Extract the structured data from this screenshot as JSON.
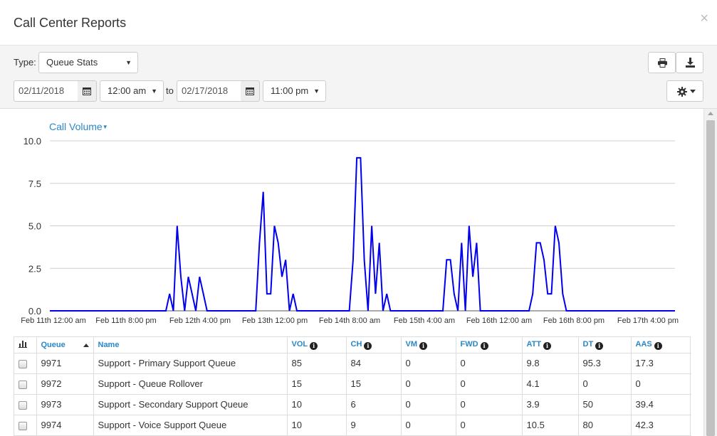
{
  "dialog": {
    "title": "Call Center Reports",
    "close_label": "×"
  },
  "filters": {
    "type_label": "Type:",
    "type_value": "Queue Stats",
    "start_date": "02/11/2018",
    "start_time": "12:00 am",
    "to_label": "to",
    "end_date": "02/17/2018",
    "end_time": "11:00 pm"
  },
  "icons": {
    "print": "print-icon",
    "download": "download-icon",
    "settings": "gear-icon",
    "calendar": "calendar-icon",
    "close": "close-icon",
    "info": "info-icon",
    "chart_columns": "bar-chart-icon"
  },
  "colors": {
    "accent": "#2a87c8",
    "series": "#0000ee"
  },
  "chart_data": {
    "type": "line",
    "title": "Call Volume",
    "xlabel": "",
    "ylabel": "",
    "ylim": [
      0,
      10
    ],
    "yticks": [
      "0.0",
      "2.5",
      "5.0",
      "7.5",
      "10.0"
    ],
    "xticks": [
      "Feb 11th 12:00 am",
      "Feb 11th 8:00 pm",
      "Feb 12th 4:00 pm",
      "Feb 13th 12:00 pm",
      "Feb 14th 8:00 am",
      "Feb 15th 4:00 am",
      "Feb 16th 12:00 am",
      "Feb 16th 8:00 pm",
      "Feb 17th 4:00 pm"
    ],
    "x_unit": "hours from Feb 11th 12:00 am",
    "grid": true,
    "series": [
      {
        "name": "Call Volume",
        "color": "#0000ee",
        "points": [
          [
            0,
            0
          ],
          [
            31,
            0
          ],
          [
            32,
            1
          ],
          [
            33,
            0
          ],
          [
            34,
            5
          ],
          [
            35,
            2
          ],
          [
            36,
            0
          ],
          [
            37,
            2
          ],
          [
            38,
            1
          ],
          [
            39,
            0
          ],
          [
            40,
            2
          ],
          [
            41,
            1
          ],
          [
            42,
            0
          ],
          [
            55,
            0
          ],
          [
            56,
            4
          ],
          [
            57,
            7
          ],
          [
            58,
            1
          ],
          [
            59,
            1
          ],
          [
            60,
            5
          ],
          [
            61,
            4
          ],
          [
            62,
            2
          ],
          [
            63,
            3
          ],
          [
            64,
            0
          ],
          [
            65,
            1
          ],
          [
            66,
            0
          ],
          [
            80,
            0
          ],
          [
            81,
            3
          ],
          [
            82,
            9
          ],
          [
            83,
            9
          ],
          [
            84,
            3
          ],
          [
            85,
            0
          ],
          [
            86,
            5
          ],
          [
            87,
            1
          ],
          [
            88,
            4
          ],
          [
            89,
            0
          ],
          [
            90,
            1
          ],
          [
            91,
            0
          ],
          [
            105,
            0
          ],
          [
            106,
            3
          ],
          [
            107,
            3
          ],
          [
            108,
            1
          ],
          [
            109,
            0
          ],
          [
            110,
            4
          ],
          [
            111,
            0
          ],
          [
            112,
            5
          ],
          [
            113,
            2
          ],
          [
            114,
            4
          ],
          [
            115,
            0
          ],
          [
            128,
            0
          ],
          [
            129,
            1
          ],
          [
            130,
            4
          ],
          [
            131,
            4
          ],
          [
            132,
            3
          ],
          [
            133,
            1
          ],
          [
            134,
            1
          ],
          [
            135,
            5
          ],
          [
            136,
            4
          ],
          [
            137,
            1
          ],
          [
            138,
            0
          ],
          [
            167,
            0
          ]
        ]
      }
    ]
  },
  "table": {
    "columns": [
      {
        "label": "",
        "info": false
      },
      {
        "label": "Queue",
        "info": false
      },
      {
        "label": "Name",
        "info": false
      },
      {
        "label": "VOL",
        "info": true
      },
      {
        "label": "CH",
        "info": true
      },
      {
        "label": "VM",
        "info": true
      },
      {
        "label": "FWD",
        "info": true
      },
      {
        "label": "ATT",
        "info": true
      },
      {
        "label": "DT",
        "info": true
      },
      {
        "label": "AAS",
        "info": true
      }
    ],
    "info_glyph": "i",
    "rows": [
      [
        "9971",
        "Support - Primary Support Queue",
        "85",
        "84",
        "0",
        "0",
        "9.8",
        "95.3",
        "17.3"
      ],
      [
        "9972",
        "Support - Queue Rollover",
        "15",
        "15",
        "0",
        "0",
        "4.1",
        "0",
        "0"
      ],
      [
        "9973",
        "Support - Secondary Support Queue",
        "10",
        "6",
        "0",
        "0",
        "3.9",
        "50",
        "39.4"
      ],
      [
        "9974",
        "Support - Voice Support Queue",
        "10",
        "9",
        "0",
        "0",
        "10.5",
        "80",
        "42.3"
      ]
    ]
  }
}
